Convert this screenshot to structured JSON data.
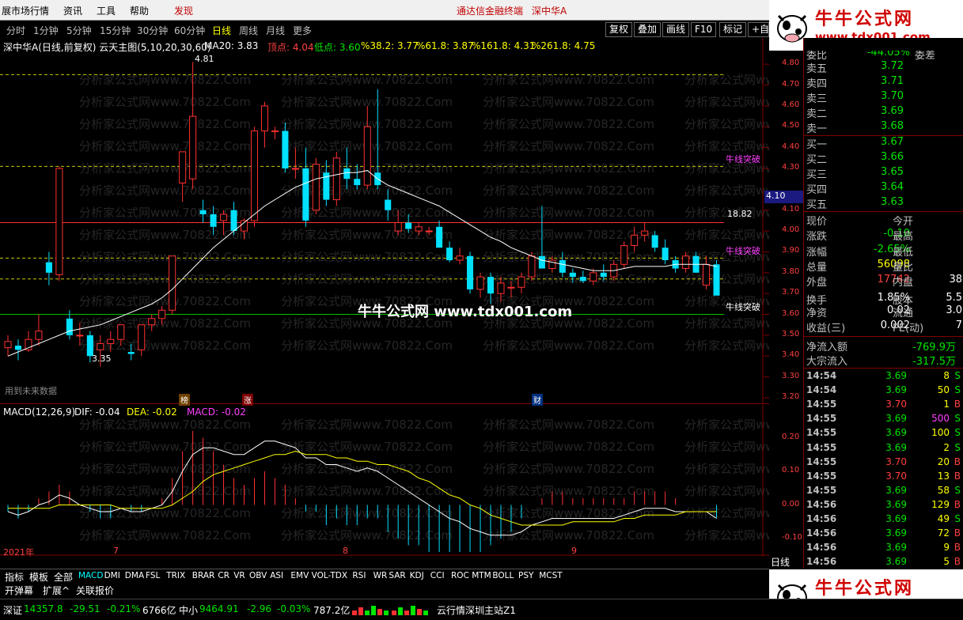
{
  "menubar": {
    "items": [
      "展市场行情",
      "资讯",
      "工具",
      "帮助",
      "发现"
    ],
    "center_text": "通达信金融终端",
    "stock_title": "深中华A"
  },
  "periodbar": {
    "items": [
      "分时",
      "1分钟",
      "5分钟",
      "15分钟",
      "30分钟",
      "60分钟",
      "日线",
      "周线",
      "月线",
      "更多"
    ],
    "active": "日线",
    "tools": [
      "复权",
      "叠加",
      "画线",
      "F10",
      "标记",
      "+自选"
    ]
  },
  "mainchart": {
    "title": "深中华A(日线,前复权) 云天主图(5,10,20,30,60)",
    "ma20": "MA20: 3.83",
    "top_label": "顶点: 4.04",
    "low_label": "低点: 3.60",
    "fib": [
      "%38.2: 3.77",
      "%61.8: 3.87",
      "%161.8: 4.31",
      "%261.8: 4.75"
    ],
    "high_marker": "4.81",
    "low_marker": "3.35",
    "level_1882": "18.82",
    "breakout1": "牛线突破",
    "breakout2": "牛线突破",
    "breakout3": "牛线突破",
    "current_price_tag": "4.10",
    "future_label": "用到未来数据",
    "event_tags": [
      "榜",
      "涨",
      "财"
    ],
    "price_axis": [
      "4.80",
      "4.70",
      "4.60",
      "4.50",
      "4.40",
      "4.30",
      "4.10",
      "4.00",
      "3.90",
      "3.80",
      "3.70",
      "3.60",
      "3.50",
      "3.40",
      "3.30",
      "3.20"
    ],
    "watermark_text": "分析家公式网www.70822.Com",
    "center_watermark": "牛牛公式网 www.tdx001.com"
  },
  "macd": {
    "title": "MACD(12,26,9)",
    "dif": "DIF: -0.04",
    "dea": "DEA: -0.02",
    "macd": "MACD: -0.02",
    "axis": [
      "0.20",
      "0.10",
      "0.00",
      "-0.10"
    ],
    "year_label": "2021年",
    "month_labels": [
      "7",
      "8",
      "9"
    ]
  },
  "quote": {
    "top_row_label": "委比",
    "top_row_value": "-44.05%",
    "top_row_label2": "委差",
    "sells": [
      {
        "label": "卖五",
        "price": "3.72"
      },
      {
        "label": "卖四",
        "price": "3.71"
      },
      {
        "label": "卖三",
        "price": "3.70"
      },
      {
        "label": "卖二",
        "price": "3.69"
      },
      {
        "label": "卖一",
        "price": "3.68"
      }
    ],
    "buys": [
      {
        "label": "买一",
        "price": "3.67"
      },
      {
        "label": "买二",
        "price": "3.66"
      },
      {
        "label": "买三",
        "price": "3.65"
      },
      {
        "label": "买四",
        "price": "3.64"
      },
      {
        "label": "买五",
        "price": "3.63"
      }
    ],
    "stats": [
      {
        "label": "现价",
        "value": "",
        "label2": "今开",
        "value2": ""
      },
      {
        "label": "涨跌",
        "value": "-0.10",
        "label2": "最高",
        "value2": ""
      },
      {
        "label": "涨幅",
        "value": "-2.65%",
        "label2": "最低",
        "value2": ""
      },
      {
        "label": "总量",
        "value": "56098",
        "label2": "量比",
        "value2": ""
      },
      {
        "label": "外盘",
        "value": "17742",
        "label2": "内盘",
        "value2": "38"
      },
      {
        "label": "换手",
        "value": "1.85%",
        "label2": "股本",
        "value2": "5.5"
      },
      {
        "label": "净资",
        "value": "0.02",
        "label2": "流通",
        "value2": "3.0"
      },
      {
        "label": "收益(三)",
        "value": "0.002",
        "label2": "PE(动)",
        "value2": "7"
      }
    ],
    "netflow_label": "净流入额",
    "netflow_value": "-769.9万",
    "block_label": "大宗流入",
    "block_value": "-317.5万",
    "ticks": [
      {
        "time": "14:54",
        "price": "3.69",
        "vol": "8",
        "side": "S"
      },
      {
        "time": "14:54",
        "price": "3.69",
        "vol": "50",
        "side": "S"
      },
      {
        "time": "14:55",
        "price": "3.70",
        "vol": "1",
        "side": "B"
      },
      {
        "time": "14:55",
        "price": "3.69",
        "vol": "500",
        "side": "S"
      },
      {
        "time": "14:55",
        "price": "3.69",
        "vol": "100",
        "side": "S"
      },
      {
        "time": "14:55",
        "price": "3.69",
        "vol": "2",
        "side": "S"
      },
      {
        "time": "14:55",
        "price": "3.70",
        "vol": "20",
        "side": "B"
      },
      {
        "time": "14:55",
        "price": "3.70",
        "vol": "13",
        "side": "B"
      },
      {
        "time": "14:55",
        "price": "3.69",
        "vol": "58",
        "side": "S"
      },
      {
        "time": "14:56",
        "price": "3.69",
        "vol": "129",
        "side": "B"
      },
      {
        "time": "14:56",
        "price": "3.69",
        "vol": "49",
        "side": "S"
      },
      {
        "time": "14:56",
        "price": "3.69",
        "vol": "72",
        "side": "B"
      },
      {
        "time": "14:56",
        "price": "3.69",
        "vol": "9",
        "side": "B"
      },
      {
        "time": "14:56",
        "price": "3.69",
        "vol": "5",
        "side": "B"
      }
    ],
    "daily_label": "日线"
  },
  "indicator_tabs": [
    "指标",
    "模板",
    "全部",
    "MACD",
    "DMI",
    "DMA",
    "FSL",
    "TRIX",
    "BRAR",
    "CR",
    "VR",
    "OBV",
    "ASI",
    "EMV",
    "VOL-TDX",
    "RSI",
    "WR",
    "SAR",
    "KDJ",
    "CCI",
    "ROC",
    "MTM",
    "BOLL",
    "PSY",
    "MCST"
  ],
  "active_indicator": "MACD",
  "bottom_tools": [
    "开弹幕",
    "扩展^",
    "关联报价"
  ],
  "statusbar": {
    "sz_label": "深证",
    "sz_value": "14357.8",
    "sz_change": "-29.51",
    "sz_pct": "-0.21%",
    "sz_amount": "6766亿",
    "zx_label": "中小",
    "zx_value": "9464.91",
    "zx_change": "-2.96",
    "zx_pct": "-0.03%",
    "zx_amount": "787.2亿",
    "server": "云行情深圳主站Z1"
  },
  "ads": {
    "title": "牛牛公式网",
    "url": "www.tdx001.com"
  },
  "colors": {
    "up": "#ff3030",
    "down": "#00e0ff",
    "ma": "#ffffff",
    "fib_line": "#c8c800",
    "macd_dea": "#ffff00",
    "macd_dif": "#ffffff"
  },
  "chart_data": {
    "type": "candlestick",
    "title": "深中华A(日线,前复权) 云天主图(5,10,20,30,60)",
    "candles": [
      {
        "o": 3.44,
        "h": 3.5,
        "l": 3.4,
        "c": 3.47
      },
      {
        "o": 3.45,
        "h": 3.48,
        "l": 3.38,
        "c": 3.43
      },
      {
        "o": 3.43,
        "h": 3.52,
        "l": 3.42,
        "c": 3.48
      },
      {
        "o": 3.48,
        "h": 3.6,
        "l": 3.45,
        "c": 3.52
      },
      {
        "o": 3.85,
        "h": 3.9,
        "l": 3.74,
        "c": 3.8
      },
      {
        "o": 3.79,
        "h": 4.31,
        "l": 3.76,
        "c": 4.3
      },
      {
        "o": 3.58,
        "h": 3.62,
        "l": 3.48,
        "c": 3.5
      },
      {
        "o": 3.5,
        "h": 3.56,
        "l": 3.45,
        "c": 3.5
      },
      {
        "o": 3.5,
        "h": 3.52,
        "l": 3.37,
        "c": 3.4
      },
      {
        "o": 3.43,
        "h": 3.5,
        "l": 3.35,
        "c": 3.46
      },
      {
        "o": 3.46,
        "h": 3.52,
        "l": 3.42,
        "c": 3.48
      },
      {
        "o": 3.48,
        "h": 3.55,
        "l": 3.45,
        "c": 3.55
      },
      {
        "o": 3.42,
        "h": 3.46,
        "l": 3.38,
        "c": 3.41
      },
      {
        "o": 3.43,
        "h": 3.55,
        "l": 3.4,
        "c": 3.55
      },
      {
        "o": 3.55,
        "h": 3.6,
        "l": 3.52,
        "c": 3.58
      },
      {
        "o": 3.58,
        "h": 3.64,
        "l": 3.55,
        "c": 3.62
      },
      {
        "o": 3.62,
        "h": 3.88,
        "l": 3.6,
        "c": 3.88
      },
      {
        "o": 4.23,
        "h": 4.37,
        "l": 4.14,
        "c": 4.38
      },
      {
        "o": 4.25,
        "h": 4.81,
        "l": 4.2,
        "c": 4.55
      },
      {
        "o": 4.1,
        "h": 4.15,
        "l": 4.04,
        "c": 4.08
      },
      {
        "o": 4.08,
        "h": 4.12,
        "l": 3.98,
        "c": 4.02
      },
      {
        "o": 4.05,
        "h": 4.1,
        "l": 3.98,
        "c": 4.08
      },
      {
        "o": 4.1,
        "h": 4.14,
        "l": 3.98,
        "c": 4.0
      },
      {
        "o": 4.0,
        "h": 4.06,
        "l": 3.96,
        "c": 4.05
      },
      {
        "o": 4.05,
        "h": 4.5,
        "l": 4.02,
        "c": 4.48
      },
      {
        "o": 4.48,
        "h": 4.62,
        "l": 4.4,
        "c": 4.6
      },
      {
        "o": 4.48,
        "h": 4.5,
        "l": 4.44,
        "c": 4.48
      },
      {
        "o": 4.48,
        "h": 4.52,
        "l": 4.28,
        "c": 4.3
      },
      {
        "o": 4.3,
        "h": 4.4,
        "l": 4.25,
        "c": 4.3
      },
      {
        "o": 4.3,
        "h": 4.4,
        "l": 4.02,
        "c": 4.05
      },
      {
        "o": 4.1,
        "h": 4.35,
        "l": 4.08,
        "c": 4.32
      },
      {
        "o": 4.28,
        "h": 4.34,
        "l": 4.12,
        "c": 4.15
      },
      {
        "o": 4.15,
        "h": 4.38,
        "l": 4.12,
        "c": 4.35
      },
      {
        "o": 4.3,
        "h": 4.4,
        "l": 4.2,
        "c": 4.25
      },
      {
        "o": 4.25,
        "h": 4.32,
        "l": 4.2,
        "c": 4.22
      },
      {
        "o": 4.22,
        "h": 4.6,
        "l": 4.2,
        "c": 4.5
      },
      {
        "o": 4.28,
        "h": 4.68,
        "l": 4.2,
        "c": 4.22
      },
      {
        "o": 4.15,
        "h": 4.2,
        "l": 4.05,
        "c": 4.1
      },
      {
        "o": 4.0,
        "h": 4.1,
        "l": 3.98,
        "c": 4.04
      },
      {
        "o": 4.04,
        "h": 4.08,
        "l": 3.99,
        "c": 4.01
      },
      {
        "o": 4.0,
        "h": 4.04,
        "l": 3.98,
        "c": 4.02
      },
      {
        "o": 4.0,
        "h": 4.02,
        "l": 3.98,
        "c": 4.0
      },
      {
        "o": 4.02,
        "h": 4.05,
        "l": 3.96,
        "c": 3.92
      },
      {
        "o": 3.92,
        "h": 3.95,
        "l": 3.85,
        "c": 3.86
      },
      {
        "o": 3.86,
        "h": 3.92,
        "l": 3.84,
        "c": 3.88
      },
      {
        "o": 3.88,
        "h": 3.9,
        "l": 3.7,
        "c": 3.72
      },
      {
        "o": 3.72,
        "h": 3.8,
        "l": 3.68,
        "c": 3.78
      },
      {
        "o": 3.78,
        "h": 3.8,
        "l": 3.65,
        "c": 3.7
      },
      {
        "o": 3.7,
        "h": 3.78,
        "l": 3.66,
        "c": 3.75
      },
      {
        "o": 3.73,
        "h": 3.76,
        "l": 3.68,
        "c": 3.73
      },
      {
        "o": 3.73,
        "h": 3.8,
        "l": 3.7,
        "c": 3.78
      },
      {
        "o": 3.78,
        "h": 3.9,
        "l": 3.76,
        "c": 3.88
      },
      {
        "o": 3.88,
        "h": 4.12,
        "l": 3.82,
        "c": 3.82
      },
      {
        "o": 3.82,
        "h": 3.88,
        "l": 3.8,
        "c": 3.86
      },
      {
        "o": 3.86,
        "h": 3.9,
        "l": 3.78,
        "c": 3.8
      },
      {
        "o": 3.8,
        "h": 3.82,
        "l": 3.75,
        "c": 3.78
      },
      {
        "o": 3.78,
        "h": 3.81,
        "l": 3.75,
        "c": 3.76
      },
      {
        "o": 3.76,
        "h": 3.82,
        "l": 3.74,
        "c": 3.8
      },
      {
        "o": 3.8,
        "h": 3.84,
        "l": 3.76,
        "c": 3.78
      },
      {
        "o": 3.78,
        "h": 3.86,
        "l": 3.76,
        "c": 3.84
      },
      {
        "o": 3.84,
        "h": 3.95,
        "l": 3.82,
        "c": 3.93
      },
      {
        "o": 3.93,
        "h": 4.02,
        "l": 3.9,
        "c": 3.98
      },
      {
        "o": 3.98,
        "h": 4.04,
        "l": 3.95,
        "c": 4.0
      },
      {
        "o": 3.98,
        "h": 4.0,
        "l": 3.9,
        "c": 3.92
      },
      {
        "o": 3.92,
        "h": 3.96,
        "l": 3.84,
        "c": 3.86
      },
      {
        "o": 3.86,
        "h": 3.88,
        "l": 3.8,
        "c": 3.82
      },
      {
        "o": 3.82,
        "h": 3.9,
        "l": 3.8,
        "c": 3.88
      },
      {
        "o": 3.88,
        "h": 3.9,
        "l": 3.8,
        "c": 3.8
      },
      {
        "o": 3.74,
        "h": 3.88,
        "l": 3.72,
        "c": 3.84
      },
      {
        "o": 3.84,
        "h": 3.86,
        "l": 3.7,
        "c": 3.69
      }
    ],
    "ma20": [
      3.4,
      3.42,
      3.44,
      3.46,
      3.48,
      3.5,
      3.52,
      3.53,
      3.54,
      3.55,
      3.57,
      3.59,
      3.61,
      3.63,
      3.65,
      3.68,
      3.72,
      3.77,
      3.82,
      3.87,
      3.92,
      3.96,
      4.0,
      4.04,
      4.08,
      4.12,
      4.15,
      4.18,
      4.21,
      4.23,
      4.25,
      4.26,
      4.27,
      4.28,
      4.28,
      4.29,
      4.25,
      4.22,
      4.2,
      4.18,
      4.16,
      4.14,
      4.12,
      4.09,
      4.06,
      4.03,
      4.0,
      3.97,
      3.95,
      3.92,
      3.9,
      3.88,
      3.86,
      3.85,
      3.84,
      3.83,
      3.82,
      3.81,
      3.81,
      3.81,
      3.82,
      3.83,
      3.83,
      3.83,
      3.83,
      3.84,
      3.84,
      3.84,
      3.84,
      3.83
    ],
    "hlines": [
      {
        "y": 4.75,
        "color": "#c8c800",
        "style": "dashed"
      },
      {
        "y": 4.31,
        "color": "#c8c800",
        "style": "dashed"
      },
      {
        "y": 4.04,
        "color": "#ff3030",
        "style": "solid"
      },
      {
        "y": 3.87,
        "color": "#c8c800",
        "style": "dashed"
      },
      {
        "y": 3.77,
        "color": "#c8c800",
        "style": "dashed"
      },
      {
        "y": 3.6,
        "color": "#00c000",
        "style": "solid"
      }
    ],
    "ylim": [
      3.2,
      4.85
    ],
    "macd_dif": [
      -0.02,
      -0.03,
      -0.02,
      0.0,
      0.01,
      0.03,
      0.02,
      0.0,
      -0.01,
      -0.02,
      -0.02,
      -0.01,
      -0.02,
      -0.02,
      -0.01,
      0.0,
      0.04,
      0.1,
      0.15,
      0.17,
      0.17,
      0.16,
      0.15,
      0.15,
      0.17,
      0.19,
      0.19,
      0.18,
      0.17,
      0.14,
      0.14,
      0.12,
      0.12,
      0.11,
      0.1,
      0.11,
      0.1,
      0.08,
      0.06,
      0.04,
      0.02,
      0.0,
      -0.02,
      -0.04,
      -0.05,
      -0.07,
      -0.08,
      -0.09,
      -0.09,
      -0.09,
      -0.08,
      -0.06,
      -0.05,
      -0.04,
      -0.04,
      -0.04,
      -0.04,
      -0.04,
      -0.04,
      -0.04,
      -0.03,
      -0.02,
      -0.01,
      -0.01,
      -0.01,
      -0.02,
      -0.02,
      -0.02,
      -0.02,
      -0.04
    ],
    "macd_dea": [
      -0.01,
      -0.01,
      -0.01,
      -0.01,
      -0.01,
      0.0,
      0.0,
      0.0,
      0.0,
      0.0,
      0.0,
      -0.01,
      -0.01,
      -0.01,
      -0.01,
      -0.01,
      0.0,
      0.02,
      0.04,
      0.07,
      0.09,
      0.1,
      0.11,
      0.12,
      0.13,
      0.14,
      0.15,
      0.15,
      0.16,
      0.15,
      0.15,
      0.15,
      0.14,
      0.14,
      0.13,
      0.13,
      0.12,
      0.12,
      0.11,
      0.1,
      0.08,
      0.07,
      0.05,
      0.03,
      0.02,
      0.0,
      -0.01,
      -0.03,
      -0.04,
      -0.05,
      -0.06,
      -0.06,
      -0.06,
      -0.06,
      -0.06,
      -0.05,
      -0.05,
      -0.05,
      -0.05,
      -0.05,
      -0.04,
      -0.04,
      -0.03,
      -0.03,
      -0.03,
      -0.03,
      -0.02,
      -0.02,
      -0.02,
      -0.02
    ],
    "macd_ylim": [
      -0.14,
      0.26
    ]
  }
}
